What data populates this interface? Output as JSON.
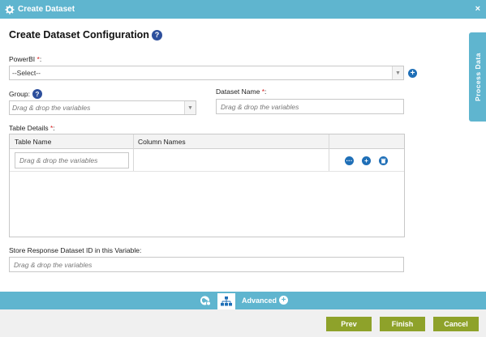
{
  "window": {
    "title": "Create Dataset",
    "close_label": "×"
  },
  "page": {
    "heading": "Create Dataset Configuration",
    "help_glyph": "?"
  },
  "powerbi": {
    "label": "PowerBI ",
    "required_mark": "*",
    "colon": ":",
    "selected": "--Select--"
  },
  "group": {
    "label": "Group:",
    "placeholder": "Drag & drop the variables"
  },
  "dataset_name": {
    "label": "Dataset Name ",
    "required_mark": "*",
    "colon": ":",
    "placeholder": "Drag & drop the variables"
  },
  "table_details": {
    "label": "Table Details ",
    "required_mark": "*",
    "colon": ":",
    "columns": [
      "Table Name",
      "Column Names"
    ],
    "rows": [
      {
        "table_name_placeholder": "Drag & drop the variables",
        "column_names": ""
      }
    ]
  },
  "store_response": {
    "label": "Store Response Dataset ID in this Variable:",
    "placeholder": "Drag & drop the variables"
  },
  "side_tab": {
    "label": "Process Data"
  },
  "bottom_bar": {
    "advanced_label": "Advanced"
  },
  "footer": {
    "prev": "Prev",
    "finish": "Finish",
    "cancel": "Cancel"
  },
  "colors": {
    "accent": "#5fb5cf",
    "button": "#8ea22a",
    "icon_blue": "#1f6fb7",
    "required": "#d42020"
  }
}
